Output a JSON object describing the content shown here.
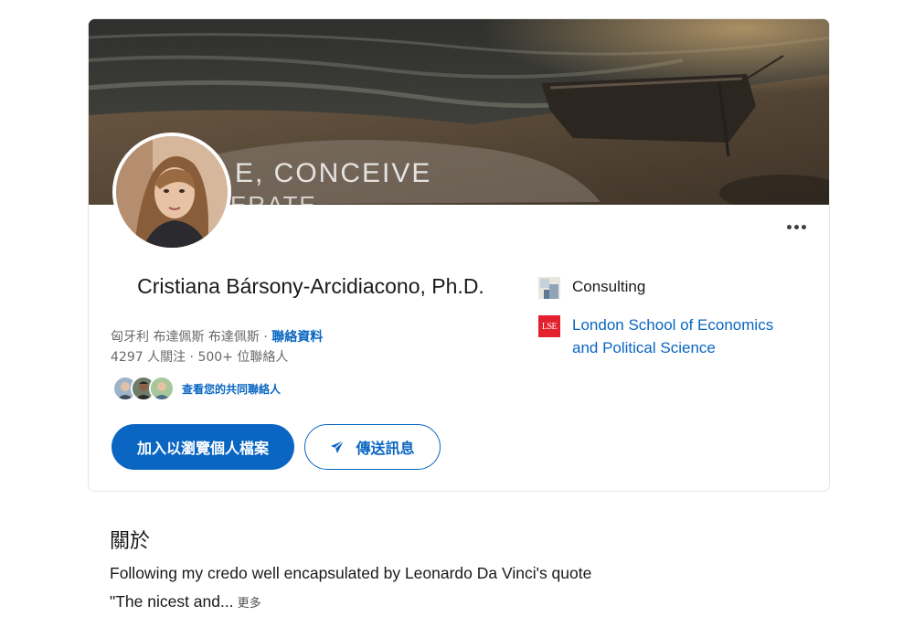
{
  "profile": {
    "cover_text_line1": "E, CONCEIVE",
    "cover_text_line2": "ERATE",
    "name": "Cristiana Bársony-Arcidiacono, Ph.D.",
    "location": "匈牙利 布達佩斯 布達佩斯",
    "location_separator": " · ",
    "contact_link": "聯絡資料",
    "followers_count": "4297 人關注",
    "connections_separator": " · ",
    "connections": "500+ 位聯絡人",
    "mutual_connections": "查看您的共同聯絡人"
  },
  "actions": {
    "primary": "加入以瀏覽個人檔案",
    "secondary": "傳送訊息"
  },
  "organizations": [
    {
      "name": "Consulting",
      "logo": "company-logo-placeholder"
    },
    {
      "name": "London School of Economics and Political Science",
      "logo": "LSE"
    }
  ],
  "about": {
    "title": "關於",
    "line1": "Following my credo well encapsulated by Leonardo Da Vinci's quote",
    "line2": "\"The nicest and...",
    "more": "更多"
  },
  "colors": {
    "primary": "#0a66c2",
    "lse_red": "#e4212e"
  }
}
